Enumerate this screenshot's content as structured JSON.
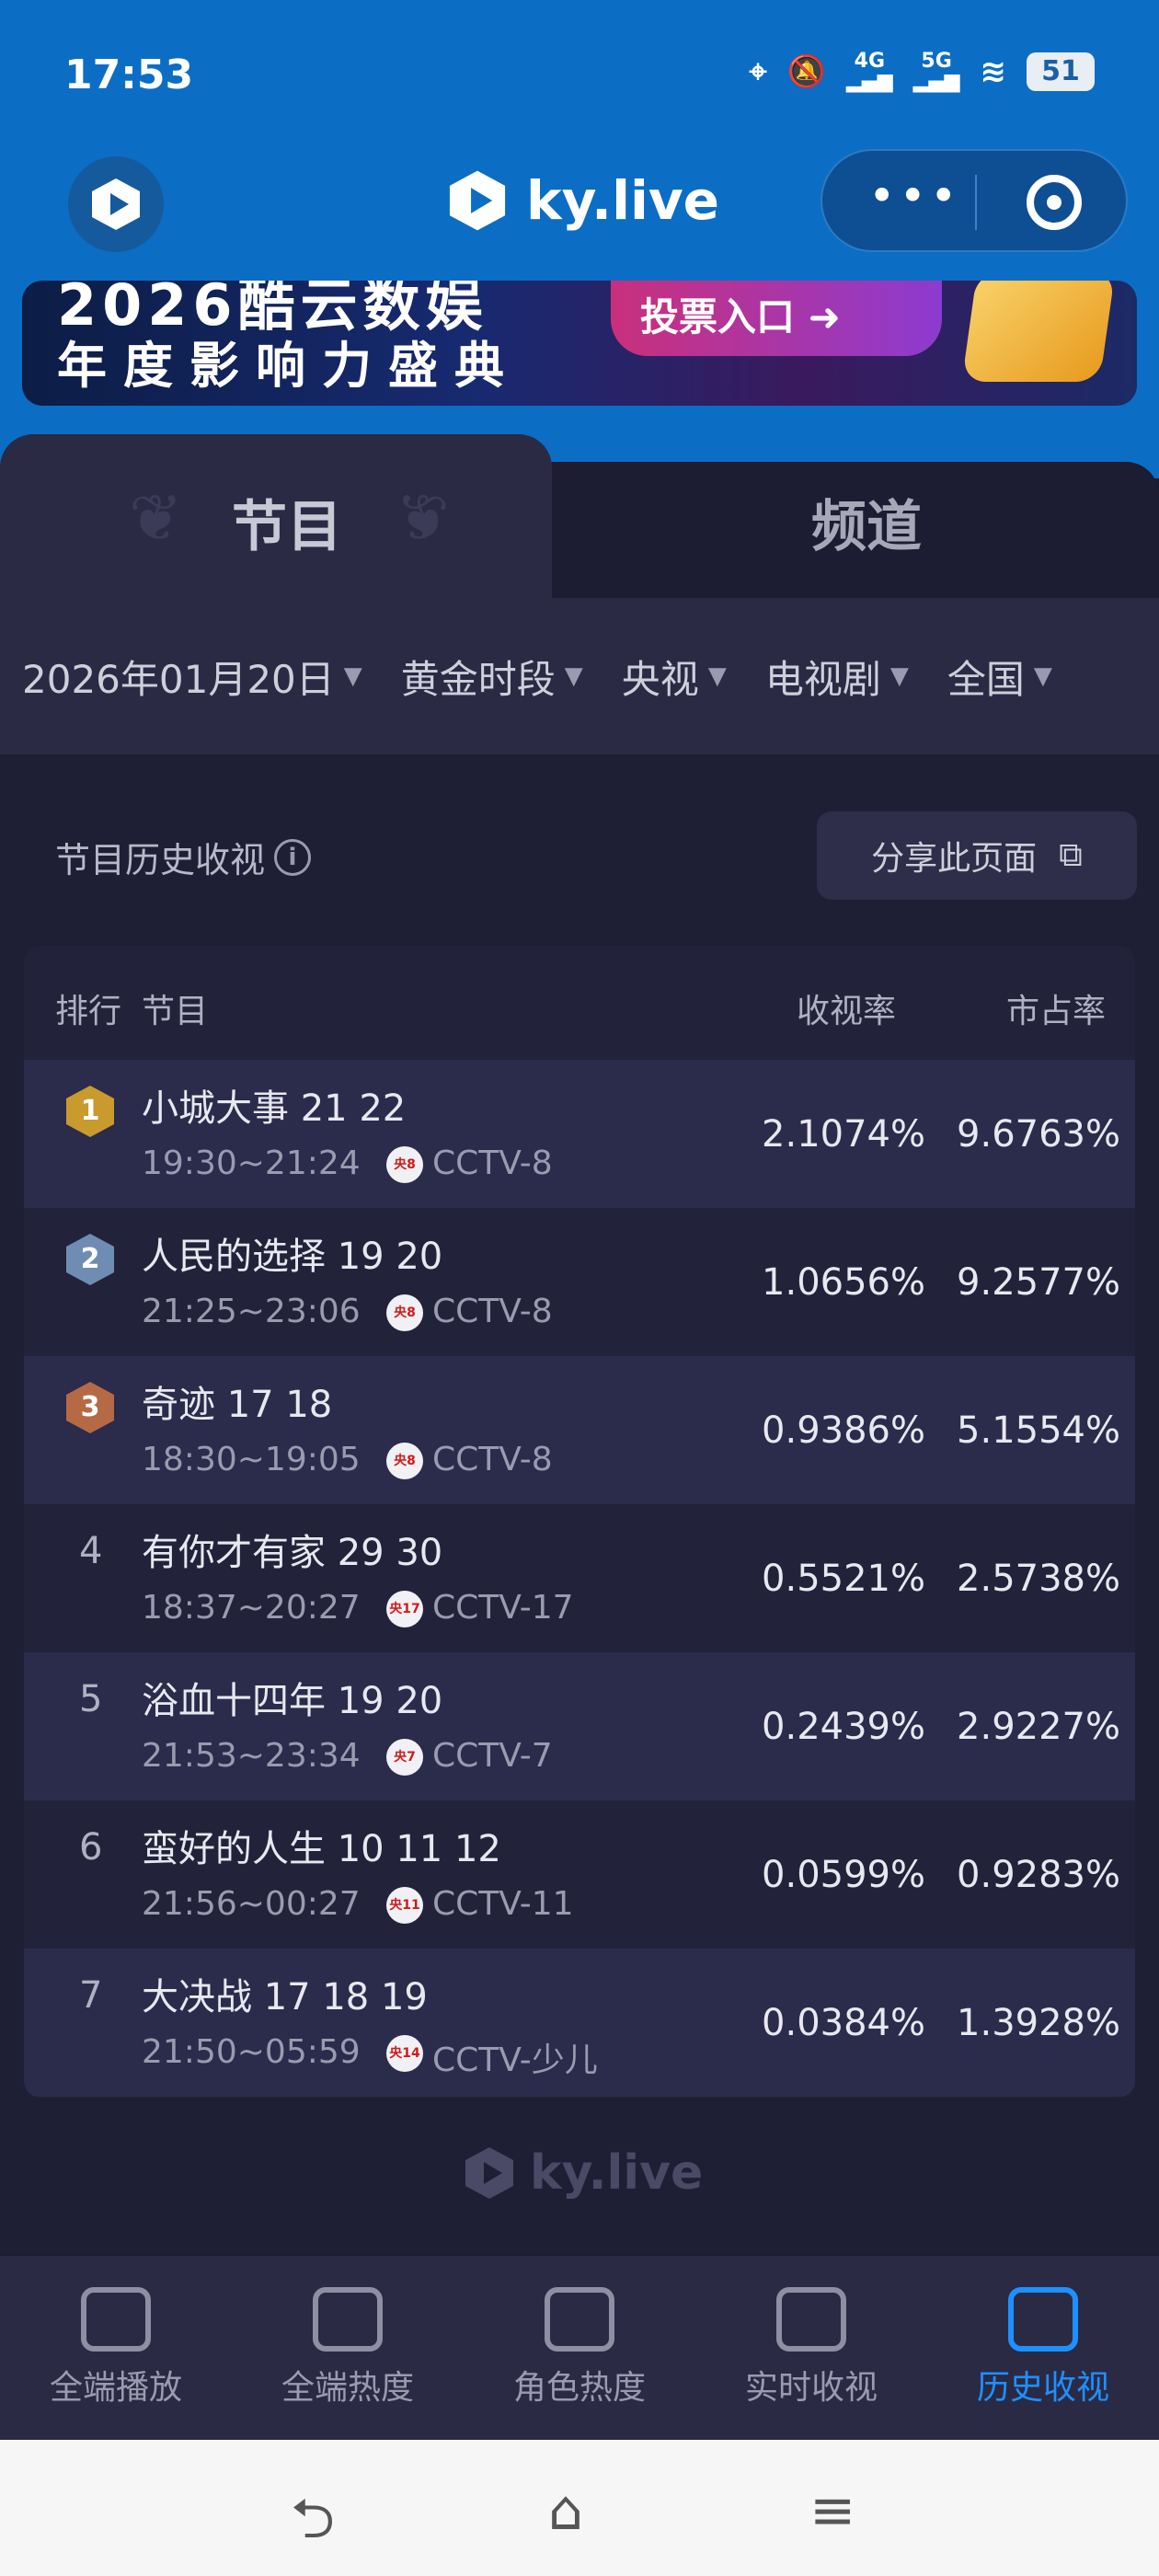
{
  "status_bar": {
    "time": "17:53",
    "net1": "4G",
    "net2": "5G",
    "battery": "51"
  },
  "app_bar": {
    "brand": "ky.live"
  },
  "banner": {
    "line1": "2026酷云数娱",
    "line2": "年度影响力盛典",
    "vote": "投票入口 ➜"
  },
  "tabs": [
    {
      "label": "节目"
    },
    {
      "label": "频道"
    }
  ],
  "filters": [
    {
      "label": "2026年01月20日"
    },
    {
      "label": "黄金时段"
    },
    {
      "label": "央视"
    },
    {
      "label": "电视剧"
    },
    {
      "label": "全国"
    }
  ],
  "section": {
    "title": "节目历史收视",
    "info": "i",
    "share_button": "分享此页面"
  },
  "table": {
    "headers": {
      "rank": "排行",
      "program": "节目",
      "rating": "收视率",
      "share": "市占率"
    },
    "rows": [
      {
        "rank": "1",
        "name": "小城大事 21 22",
        "time": "19:30~21:24",
        "ch_badge": "央8",
        "channel": "CCTV-8",
        "rating": "2.1074%",
        "share": "9.6763%",
        "medal_color": "#c99a2e"
      },
      {
        "rank": "2",
        "name": "人民的选择 19 20",
        "time": "21:25~23:06",
        "ch_badge": "央8",
        "channel": "CCTV-8",
        "rating": "1.0656%",
        "share": "9.2577%",
        "medal_color": "#6f8db3"
      },
      {
        "rank": "3",
        "name": "奇迹 17 18",
        "time": "18:30~19:05",
        "ch_badge": "央8",
        "channel": "CCTV-8",
        "rating": "0.9386%",
        "share": "5.1554%",
        "medal_color": "#b56a45"
      },
      {
        "rank": "4",
        "name": "有你才有家 29 30",
        "time": "18:37~20:27",
        "ch_badge": "央17",
        "channel": "CCTV-17",
        "rating": "0.5521%",
        "share": "2.5738%"
      },
      {
        "rank": "5",
        "name": "浴血十四年 19 20",
        "time": "21:53~23:34",
        "ch_badge": "央7",
        "channel": "CCTV-7",
        "rating": "0.2439%",
        "share": "2.9227%"
      },
      {
        "rank": "6",
        "name": "蛮好的人生 10 11 12",
        "time": "21:56~00:27",
        "ch_badge": "央11",
        "channel": "CCTV-11",
        "rating": "0.0599%",
        "share": "0.9283%"
      },
      {
        "rank": "7",
        "name": "大决战 17 18 19",
        "time": "21:50~05:59",
        "ch_badge": "央14",
        "channel": "CCTV-少儿",
        "rating": "0.0384%",
        "share": "1.3928%"
      }
    ]
  },
  "footer": {
    "brand": "ky.live"
  },
  "bottom_nav": [
    {
      "label": "全端播放",
      "icon": "play-stats-icon"
    },
    {
      "label": "全端热度",
      "icon": "flame-icon"
    },
    {
      "label": "角色热度",
      "icon": "user-icon"
    },
    {
      "label": "实时收视",
      "icon": "tv-icon"
    },
    {
      "label": "历史收视",
      "icon": "history-icon",
      "active": true
    }
  ],
  "system_nav": {
    "back": "⮌",
    "home": "⌂",
    "menu": "≡"
  },
  "colors": {
    "brand_blue": "#0b6ec4",
    "active_nav": "#1e90ff",
    "background": "#1e1e35"
  }
}
